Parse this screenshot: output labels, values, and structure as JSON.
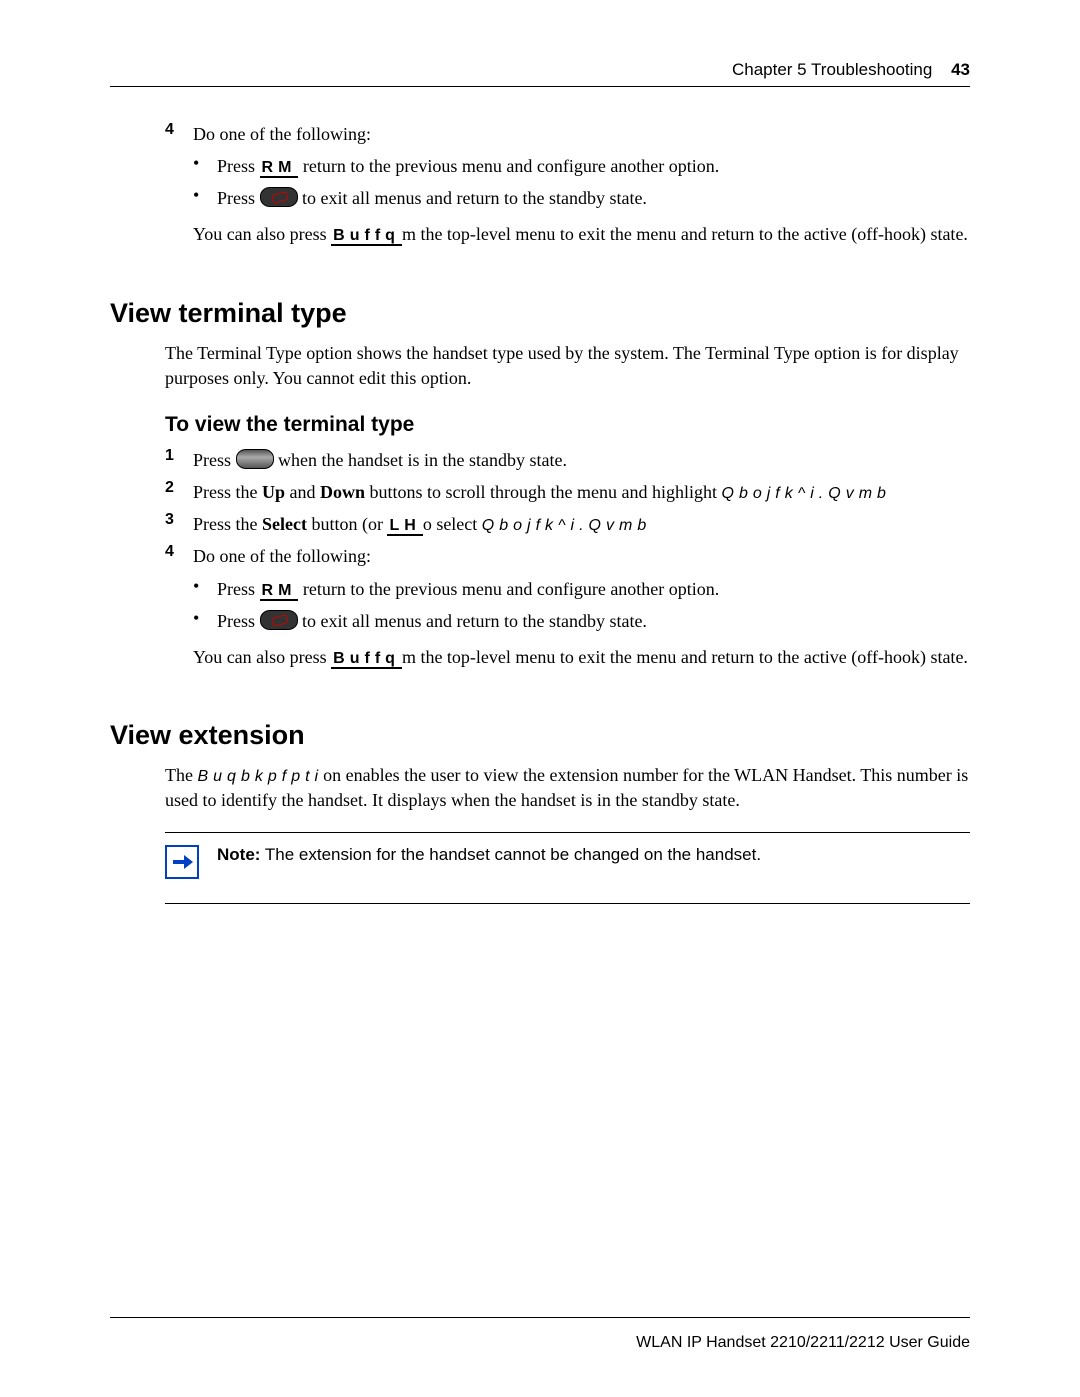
{
  "header": {
    "chapter": "Chapter 5  Troubleshooting",
    "page_number": "43"
  },
  "top_step": {
    "num": "4",
    "lead": "Do one of the following:",
    "bullets": [
      {
        "pre": "Press ",
        "key": "RM",
        "post": " return to the previous menu and configure another option."
      },
      {
        "pre": "Press ",
        "has_oval": true,
        "post": " to exit all menus and return to the standby state."
      }
    ],
    "after_pre": "You can also press ",
    "after_key": "Buffq",
    "after_post": "m the top-level menu to exit the menu and return to the active (off-hook) state."
  },
  "sec1": {
    "heading": "View terminal type",
    "intro": "The Terminal Type option shows the handset type used by the system. The Terminal Type option is for display purposes only. You cannot edit this option.",
    "subheading": "To view the terminal type",
    "steps": {
      "s1": {
        "num": "1",
        "pre": "Press ",
        "has_oval": true,
        "post": " when the handset is in the standby state."
      },
      "s2": {
        "num": "2",
        "pre": "Press the ",
        "b1": "Up",
        "mid1": " and ",
        "b2": "Down",
        "mid2": " buttons to scroll through the menu and highlight ",
        "mono": "Qbojfk^i.Qvmb"
      },
      "s3": {
        "num": "3",
        "pre": "Press the ",
        "b1": "Select",
        "mid1": " button (or ",
        "key": "LH",
        "mid2": "o select ",
        "mono": "Qbojfk^i.Qvmb"
      },
      "s4": {
        "num": "4",
        "lead": "Do one of the following:",
        "bullets": [
          {
            "pre": "Press ",
            "key": "RM",
            "post": " return to the previous menu and configure another option."
          },
          {
            "pre": "Press ",
            "has_oval": true,
            "post": " to exit all menus and return to the standby state."
          }
        ],
        "after_pre": "You can also press ",
        "after_key": "Buffq",
        "after_post": "m the top-level menu to exit the menu and return to the active (off-hook) state."
      }
    }
  },
  "sec2": {
    "heading": "View extension",
    "intro_pre": "The ",
    "intro_key": "Buqbkpfpti",
    "intro_post": "on enables the user to view the extension number for the WLAN Handset. This number is used to identify the handset. It displays when the handset is in the standby state.",
    "note_label": "Note:",
    "note_text": " The extension for the handset cannot be changed on the handset."
  },
  "footer": "WLAN IP Handset 2210/2211/2212 User Guide"
}
